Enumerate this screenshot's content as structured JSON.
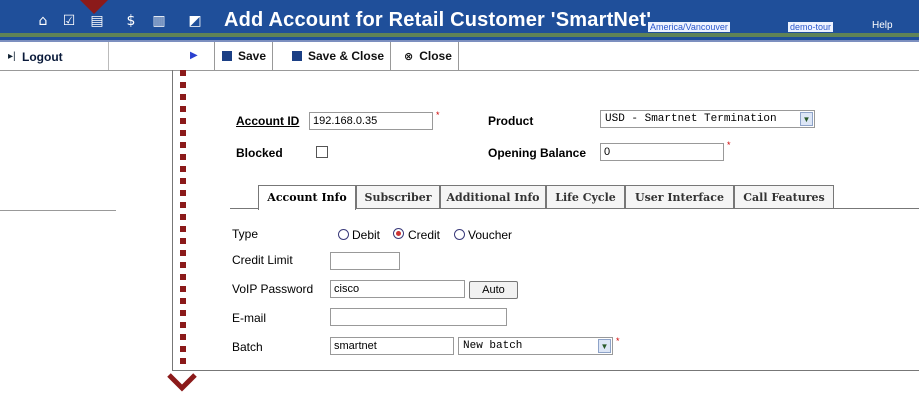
{
  "header": {
    "title": "Add Account for Retail Customer 'SmartNet'",
    "timezone": "America/Vancouver",
    "user": "demo-tour",
    "help": "Help",
    "icons": [
      "home-icon",
      "checklist-icon",
      "screen-icon",
      "dollar-icon",
      "chart-icon",
      "report-icon"
    ]
  },
  "left": {
    "logout_label": "Logout"
  },
  "toolbar": {
    "save_label": "Save",
    "save_close_label": "Save & Close",
    "close_label": "Close"
  },
  "form": {
    "account_id_label": "Account ID",
    "account_id_value": "192.168.0.35",
    "product_label": "Product",
    "product_value": "USD - Smartnet Termination",
    "blocked_label": "Blocked",
    "opening_balance_label": "Opening Balance",
    "opening_balance_value": "0"
  },
  "tabs": [
    "Account Info",
    "Subscriber",
    "Additional Info",
    "Life Cycle",
    "User Interface",
    "Call Features"
  ],
  "account_info": {
    "type_label": "Type",
    "type_options": [
      "Debit",
      "Credit",
      "Voucher"
    ],
    "type_selected": "Credit",
    "credit_limit_label": "Credit Limit",
    "credit_limit_value": "",
    "voip_password_label": "VoIP Password",
    "voip_password_value": "cisco",
    "auto_button": "Auto",
    "email_label": "E-mail",
    "email_value": "",
    "batch_label": "Batch",
    "batch_value": "smartnet",
    "batch_select": "New batch"
  },
  "colors": {
    "header_bg": "#1f4f9a",
    "annotation": "#8b1a1a",
    "link": "#2a57cc"
  }
}
